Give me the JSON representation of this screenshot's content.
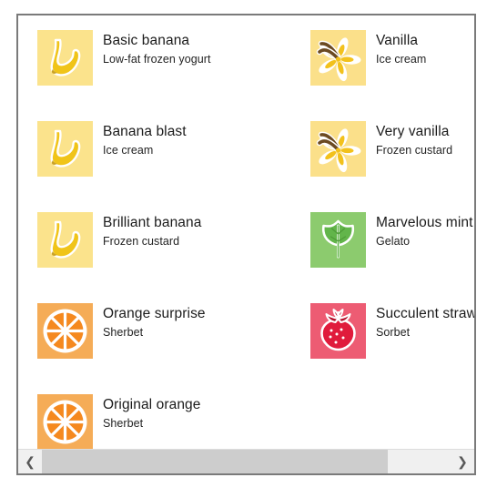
{
  "window": {
    "border_color": "#7a7a7a",
    "background": "#ffffff"
  },
  "list": {
    "columns": [
      {
        "name": "left-column",
        "items": [
          {
            "title": "Basic banana",
            "subtitle": "Low-fat frozen yogurt",
            "icon": "banana-icon",
            "tile_color": "#FBE38C",
            "art_color": "#F0C419"
          },
          {
            "title": "Banana blast",
            "subtitle": "Ice cream",
            "icon": "banana-icon",
            "tile_color": "#FBE38C",
            "art_color": "#F0C419"
          },
          {
            "title": "Brilliant banana",
            "subtitle": "Frozen custard",
            "icon": "banana-icon",
            "tile_color": "#FBE38C",
            "art_color": "#F0C419"
          },
          {
            "title": "Orange surprise",
            "subtitle": "Sherbet",
            "icon": "orange-icon",
            "tile_color": "#F5AC57",
            "art_color": "#F5891F"
          },
          {
            "title": "Original orange",
            "subtitle": "Sherbet",
            "icon": "orange-icon",
            "tile_color": "#F5AC57",
            "art_color": "#F5891F"
          }
        ]
      },
      {
        "name": "right-column",
        "items": [
          {
            "title": "Vanilla",
            "subtitle": "Ice cream",
            "icon": "vanilla-flower-icon",
            "tile_color": "#FBE08A",
            "art_color": "#F2C11C"
          },
          {
            "title": "Very vanilla",
            "subtitle": "Frozen custard",
            "icon": "vanilla-flower-icon",
            "tile_color": "#FBE08A",
            "art_color": "#F2C11C"
          },
          {
            "title": "Marvelous mint",
            "subtitle": "Gelato",
            "icon": "mint-leaf-icon",
            "tile_color": "#8CCB6E",
            "art_color": "#62B54A"
          },
          {
            "title": "Succulent strawberry",
            "subtitle": "Sorbet",
            "icon": "strawberry-icon",
            "tile_color": "#ED5C73",
            "art_color": "#C9102F"
          }
        ]
      }
    ]
  },
  "scrollbar": {
    "left_arrow": "❮",
    "right_arrow": "❯",
    "thumb_color": "#cdcdcd",
    "track_color": "#f0f0f0"
  }
}
